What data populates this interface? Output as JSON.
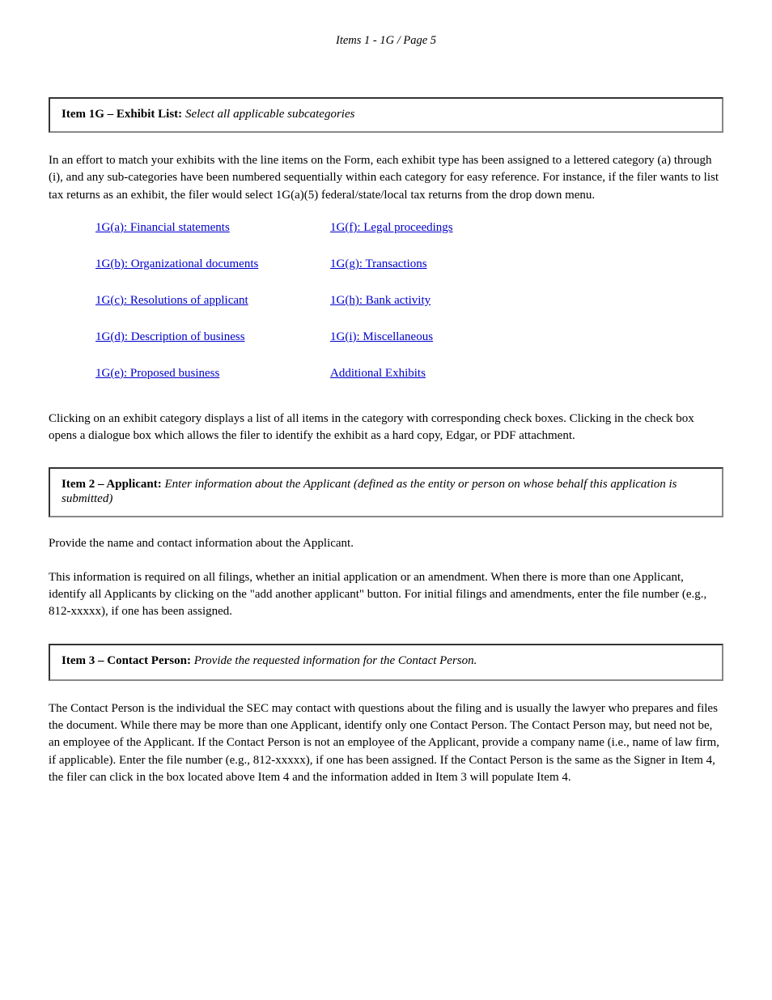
{
  "pageNumber": "Items 1 - 1G / Page 5",
  "section1g": {
    "heading": "Item 1G – Exhibit List:",
    "subtext": " Select all applicable subcategories"
  },
  "exhibitIntro": "In an effort to match your exhibits with the line items on the Form, each exhibit type has been assigned to a lettered category (a) through (i), and any sub-categories have been numbered sequentially within each category for easy reference. For instance, if the filer wants to list tax returns as an exhibit, the filer would select 1G(a)(5) federal/state/local tax returns from the drop down menu.",
  "linksCol1": [
    {
      "label": "1G(a): Financial statements"
    },
    {
      "label": "1G(b): Organizational documents"
    },
    {
      "label": "1G(c): Resolutions of applicant"
    },
    {
      "label": "1G(d): Description of business"
    },
    {
      "label": "1G(e): Proposed business"
    }
  ],
  "linksCol2": [
    {
      "label": "1G(f): Legal proceedings"
    },
    {
      "label": "1G(g): Transactions"
    },
    {
      "label": "1G(h): Bank activity"
    },
    {
      "label": "1G(i): Miscellaneous"
    },
    {
      "label": "Additional Exhibits"
    }
  ],
  "exhibitHint": "Clicking on an exhibit category displays a list of all items in the category with corresponding check boxes. Clicking in the check box opens a dialogue box which allows the filer to identify the exhibit as a hard copy, Edgar, or PDF attachment.",
  "section2c": {
    "heading": "Item 2 – Applicant:",
    "subtext": " Enter information about the Applicant (defined as the entity or person on whose behalf this application is submitted)",
    "intro": "Provide the name and contact information about the Applicant.",
    "body": "This information is required on all filings, whether an initial application or an amendment. When there is more than one Applicant, identify all Applicants by clicking on the \"add another applicant\" button. For initial filings and amendments, enter the file number (e.g., 812-xxxxx), if one has been assigned."
  },
  "section3c": {
    "heading": "Item 3 – Contact Person:",
    "subtext": " Provide the requested information for the Contact Person.",
    "body": "The Contact Person is the individual the SEC may contact with questions about the filing and is usually the lawyer who prepares and files the document. While there may be more than one Applicant, identify only one Contact Person. The Contact Person may, but need not be, an employee of the Applicant. If the Contact Person is not an employee of the Applicant, provide a company name (i.e., name of law firm, if applicable). Enter the file number (e.g., 812-xxxxx), if one has been assigned. If the Contact Person is the same as the Signer in Item 4, the filer can click in the box located above Item 4 and the information added in Item 3 will populate Item 4."
  }
}
